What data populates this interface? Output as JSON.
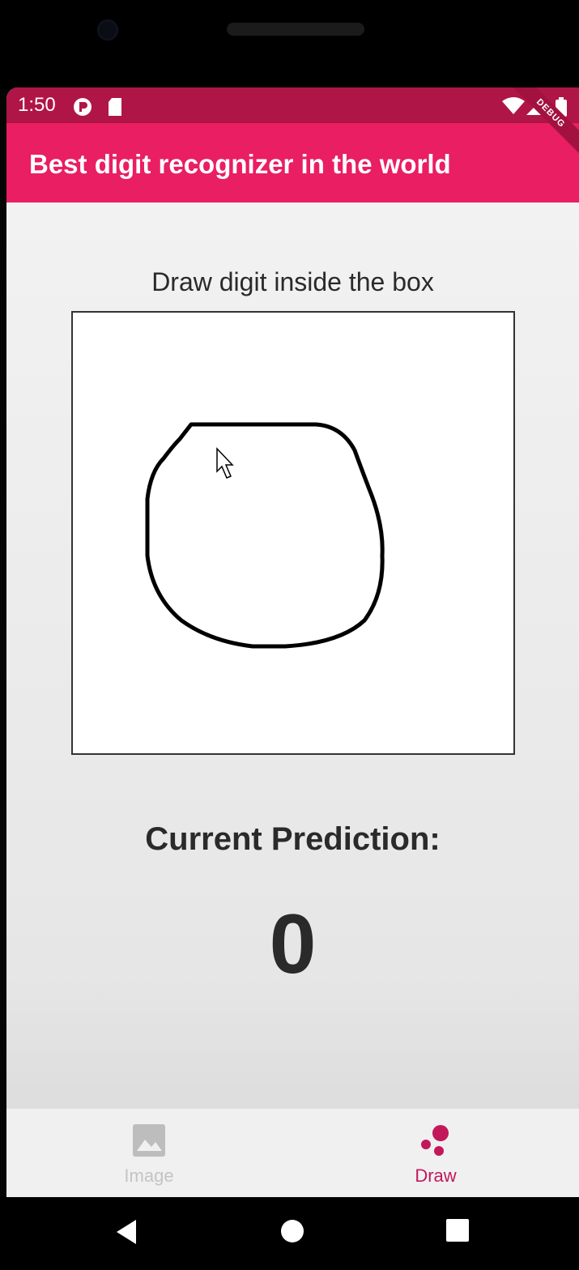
{
  "status_bar": {
    "time": "1:50",
    "icons": [
      "app-notification-icon",
      "sd-card-icon",
      "wifi-icon",
      "signal-icon",
      "battery-icon"
    ]
  },
  "app_bar": {
    "title": "Best digit recognizer in the world",
    "debug_banner": "DEBUG",
    "color": "#e91e63",
    "status_color": "#b01547"
  },
  "main": {
    "instruction": "Draw digit inside the box",
    "prediction_label": "Current Prediction:",
    "prediction_value": "0"
  },
  "fab": {
    "icon": "close-icon",
    "color": "#000000"
  },
  "bottom_nav": {
    "items": [
      {
        "label": "Image",
        "icon": "image-icon",
        "selected": false
      },
      {
        "label": "Draw",
        "icon": "draw-dots-icon",
        "selected": true
      }
    ],
    "active_color": "#c2185b",
    "inactive_color": "#bdbdbd"
  },
  "system_nav": {
    "buttons": [
      "back-icon",
      "home-icon",
      "recents-icon"
    ]
  }
}
